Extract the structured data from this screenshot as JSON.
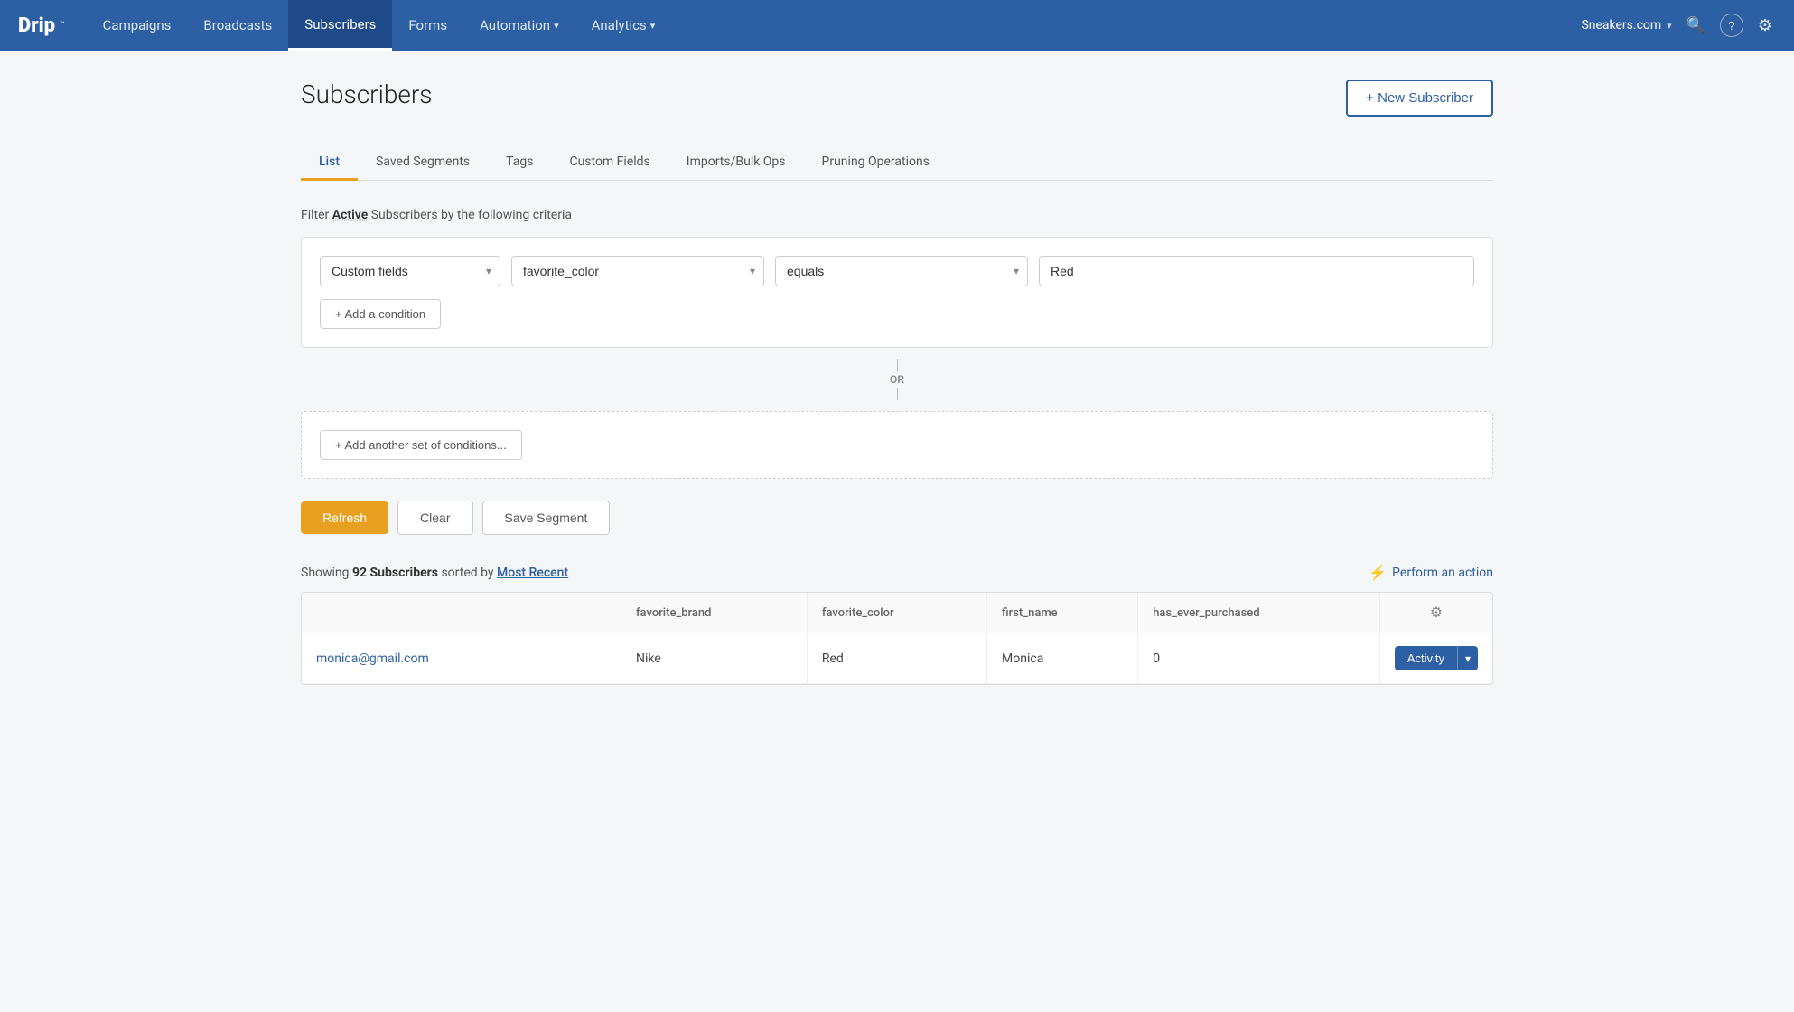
{
  "nav": {
    "logo": "Drip",
    "logo_tm": "™",
    "links": [
      {
        "label": "Campaigns",
        "active": false,
        "has_arrow": false
      },
      {
        "label": "Broadcasts",
        "active": false,
        "has_arrow": false
      },
      {
        "label": "Subscribers",
        "active": true,
        "has_arrow": false
      },
      {
        "label": "Forms",
        "active": false,
        "has_arrow": false
      },
      {
        "label": "Automation",
        "active": false,
        "has_arrow": true
      },
      {
        "label": "Analytics",
        "active": false,
        "has_arrow": true
      }
    ],
    "account": "Sneakers.com",
    "search_icon": "🔍",
    "help_icon": "?",
    "settings_icon": "⚙"
  },
  "page": {
    "title": "Subscribers",
    "new_subscriber_label": "+ New Subscriber"
  },
  "tabs": [
    {
      "label": "List",
      "active": true
    },
    {
      "label": "Saved Segments",
      "active": false
    },
    {
      "label": "Tags",
      "active": false
    },
    {
      "label": "Custom Fields",
      "active": false
    },
    {
      "label": "Imports/Bulk Ops",
      "active": false
    },
    {
      "label": "Pruning Operations",
      "active": false
    }
  ],
  "filter": {
    "prefix": "Filter",
    "status": "Active",
    "suffix": "Subscribers by the following criteria",
    "filter_type": "Custom fields",
    "field_name": "favorite_color",
    "operator": "equals",
    "value": "Red",
    "add_condition_label": "+ Add a condition",
    "add_set_label": "+ Add another set of conditions..."
  },
  "or_label": "OR",
  "buttons": {
    "refresh": "Refresh",
    "clear": "Clear",
    "save_segment": "Save Segment"
  },
  "results": {
    "prefix": "Showing",
    "count": "92 Subscribers",
    "sort_prefix": "sorted by",
    "sort": "Most Recent",
    "perform_action": "Perform an action"
  },
  "table": {
    "columns": [
      {
        "label": ""
      },
      {
        "label": "favorite_brand"
      },
      {
        "label": "favorite_color"
      },
      {
        "label": "first_name"
      },
      {
        "label": "has_ever_purchased"
      },
      {
        "label": "⚙"
      }
    ],
    "rows": [
      {
        "email": "monica@gmail.com",
        "favorite_brand": "Nike",
        "favorite_color": "Red",
        "first_name": "Monica",
        "has_ever_purchased": "0",
        "action": "Activity"
      }
    ]
  }
}
